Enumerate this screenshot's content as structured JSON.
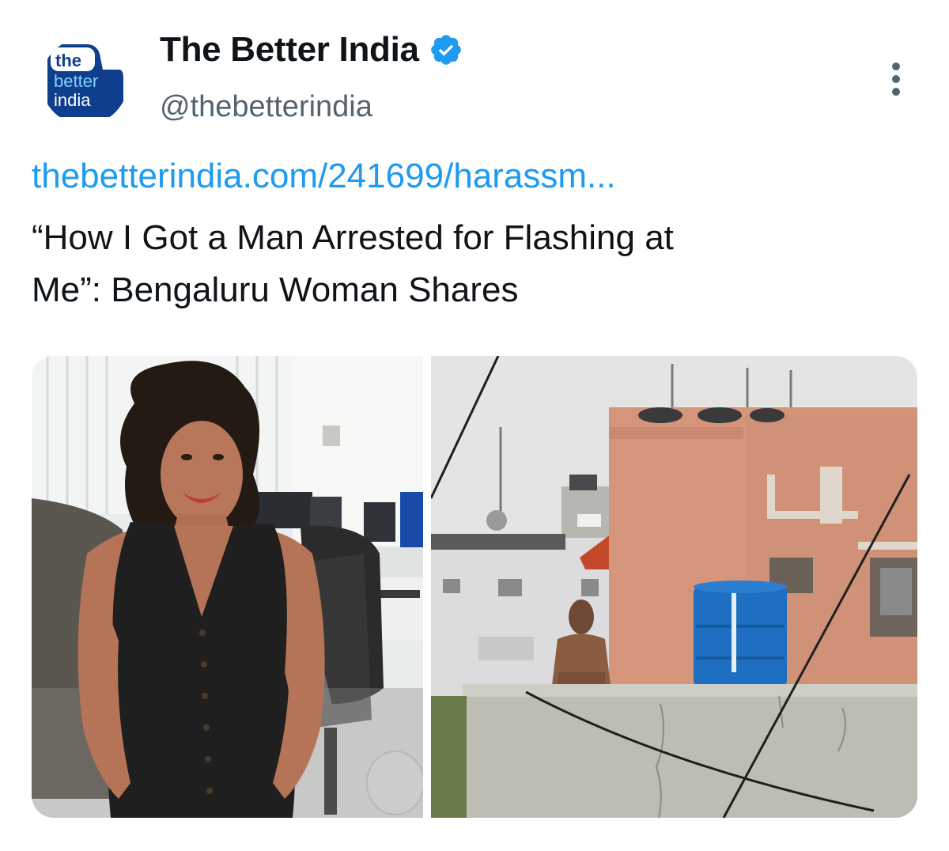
{
  "tweet": {
    "author": {
      "display_name": "The Better India",
      "handle": "@thebetterindia",
      "avatar_text": [
        "the",
        "better",
        "india"
      ],
      "verified_icon": "verified-badge-icon"
    },
    "more_icon": "more-vertical-icon",
    "link_text": "thebetterindia.com/241699/harassm...",
    "card_title_line1": "“How I Got a Man Arrested for Flashing at",
    "card_title_line2": "Me”: Bengaluru Woman Shares",
    "media_count": 2
  },
  "colors": {
    "link": "#1d9bf0",
    "handle": "#536471",
    "avatar_bg": "#0f3f8c",
    "verified": "#1d9bf0",
    "tank": "#1e6fc1"
  }
}
